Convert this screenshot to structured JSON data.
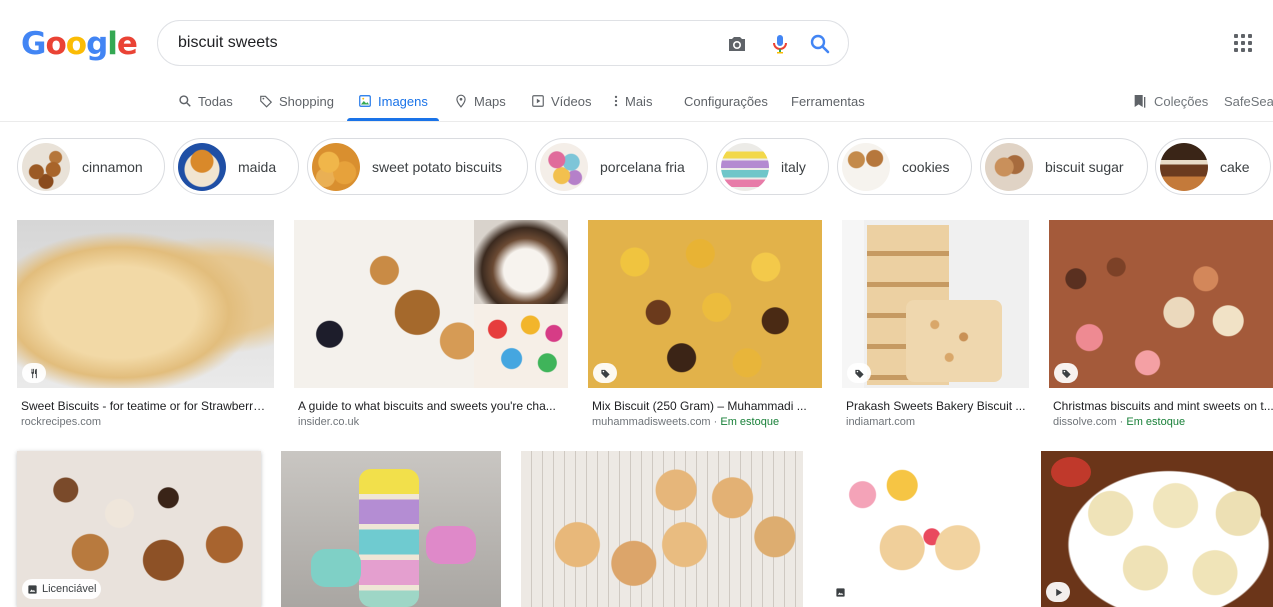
{
  "logo": {
    "letters": [
      "G",
      "o",
      "o",
      "g",
      "l",
      "e"
    ],
    "colors": [
      "#4285f4",
      "#ea4335",
      "#fbbc05",
      "#4285f4",
      "#34a853",
      "#ea4335"
    ]
  },
  "search": {
    "query": "biscuit sweets"
  },
  "tabs": [
    {
      "label": "Todas",
      "icon": "search-icon"
    },
    {
      "label": "Shopping",
      "icon": "tag-icon"
    },
    {
      "label": "Imagens",
      "icon": "image-icon",
      "active": true
    },
    {
      "label": "Maps",
      "icon": "pin-icon"
    },
    {
      "label": "Vídeos",
      "icon": "play-icon"
    },
    {
      "label": "Mais",
      "icon": "more-vert-icon"
    },
    {
      "label": "Configurações"
    },
    {
      "label": "Ferramentas"
    }
  ],
  "right": {
    "collections": "Coleções",
    "safesearch": "SafeSearch"
  },
  "chips": [
    {
      "label": "cinnamon"
    },
    {
      "label": "maida"
    },
    {
      "label": "sweet potato biscuits"
    },
    {
      "label": "porcelana fria"
    },
    {
      "label": "italy"
    },
    {
      "label": "cookies"
    },
    {
      "label": "biscuit sugar"
    },
    {
      "label": "cake"
    }
  ],
  "results_row1": [
    {
      "title": "Sweet Biscuits - for teatime or for Strawberry ...",
      "source": "rockrecipes.com",
      "badge": "fork-knife-icon"
    },
    {
      "title": "A guide to what biscuits and sweets you're cha...",
      "source": "insider.co.uk",
      "badge": ""
    },
    {
      "title": "Mix Biscuit (250 Gram) – Muhammadi ...",
      "source": "muhammadisweets.com",
      "stock": "Em estoque",
      "badge": "tag-icon"
    },
    {
      "title": "Prakash Sweets Bakery Biscuit ...",
      "source": "indiamart.com",
      "badge": "tag-icon"
    },
    {
      "title": "Christmas biscuits and mint sweets on t...",
      "source": "dissolve.com",
      "stock": "Em estoque",
      "badge": "tag-icon"
    }
  ],
  "results_row2": [
    {
      "badge_label": "Licenciável",
      "badge": "image-icon"
    },
    {
      "badge": ""
    },
    {
      "badge": ""
    },
    {
      "badge": "image-icon"
    },
    {
      "badge": "play-icon"
    }
  ],
  "dot_separator": " · "
}
